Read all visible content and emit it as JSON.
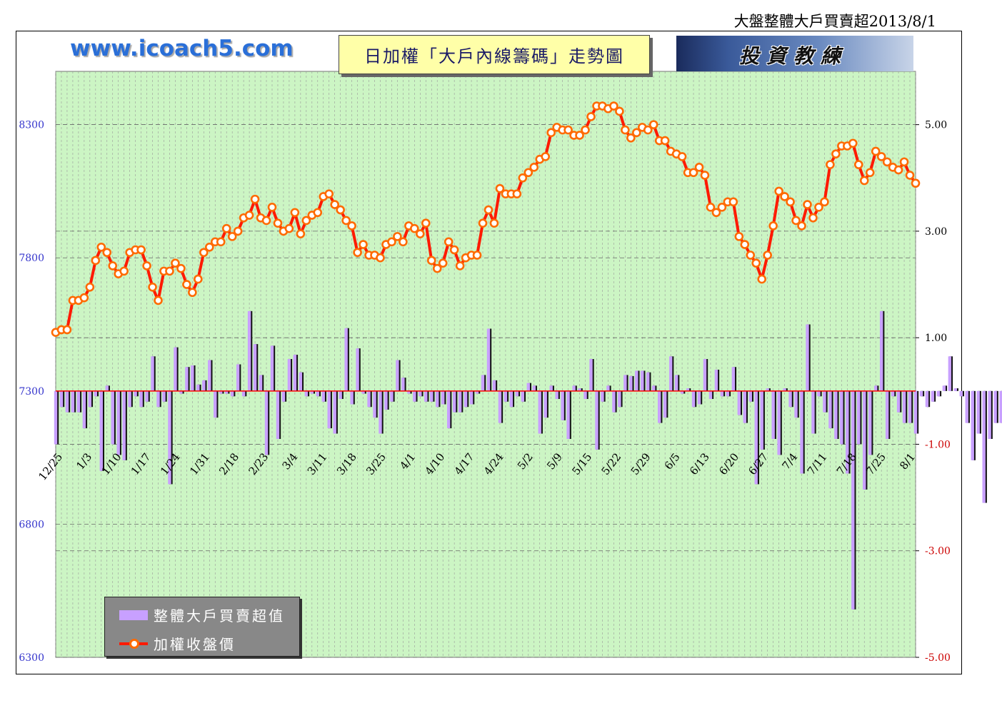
{
  "top_title": "大盤整體大戶買賣超2013/8/1",
  "site_label": "www.icoach5.com",
  "headline": "日加權「大戶內線籌碼」走勢圖",
  "logo_text": "投資教練",
  "colors": {
    "plot_bg": "#ccf5c4",
    "line": "#ff1a00",
    "marker_edge": "#ff6a00",
    "bar": "#c8a0ff",
    "left_axis_text": "#3333cc",
    "right_axis_text": "#cc0000",
    "zero_line": "#ff0000"
  },
  "legend": {
    "bar_label": "整體大戶買賣超值",
    "line_label": "加權收盤價"
  },
  "chart_data": {
    "type": "bar",
    "left_axis": {
      "ticks": [
        "8300",
        "7800",
        "7300",
        "6800",
        "6300"
      ],
      "range": [
        6300,
        8500
      ],
      "series": "加權收盤價"
    },
    "right_axis": {
      "ticks": [
        "5.00",
        "3.00",
        "1.00",
        "-1.00",
        "-3.00",
        "-5.00"
      ],
      "range": [
        -5,
        6
      ]
    },
    "x_tick_labels": [
      "12/25",
      "1/3",
      "1/10",
      "1/17",
      "1/24",
      "1/31",
      "2/18",
      "2/23",
      "3/4",
      "3/11",
      "3/18",
      "3/25",
      "4/1",
      "4/10",
      "4/17",
      "4/24",
      "5/2",
      "5/9",
      "5/15",
      "5/22",
      "5/29",
      "6/5",
      "6/13",
      "6/20",
      "6/27",
      "7/4",
      "7/11",
      "7/18",
      "7/25",
      "8/1"
    ],
    "grid": true,
    "series": [
      {
        "name": "加權收盤價",
        "type": "line",
        "values": [
          7520,
          7530,
          7530,
          7640,
          7640,
          7650,
          7690,
          7790,
          7840,
          7820,
          7770,
          7740,
          7750,
          7820,
          7830,
          7830,
          7770,
          7690,
          7640,
          7750,
          7750,
          7780,
          7760,
          7700,
          7670,
          7720,
          7820,
          7840,
          7860,
          7860,
          7910,
          7880,
          7900,
          7950,
          7960,
          8020,
          7950,
          7940,
          7990,
          7930,
          7900,
          7910,
          7970,
          7890,
          7940,
          7960,
          7970,
          8030,
          8040,
          8000,
          7980,
          7940,
          7920,
          7820,
          7850,
          7810,
          7810,
          7800,
          7850,
          7860,
          7880,
          7860,
          7920,
          7910,
          7890,
          7930,
          7790,
          7760,
          7780,
          7860,
          7830,
          7770,
          7800,
          7810,
          7810,
          7930,
          7980,
          7930,
          8060,
          8040,
          8040,
          8040,
          8100,
          8120,
          8140,
          8170,
          8180,
          8270,
          8290,
          8280,
          8280,
          8260,
          8260,
          8280,
          8330,
          8370,
          8370,
          8360,
          8370,
          8350,
          8280,
          8250,
          8270,
          8290,
          8280,
          8300,
          8240,
          8240,
          8200,
          8190,
          8180,
          8120,
          8120,
          8140,
          8110,
          7990,
          7970,
          7990,
          8010,
          8010,
          7880,
          7850,
          7810,
          7780,
          7720,
          7810,
          7920,
          8050,
          8030,
          8010,
          7940,
          7920,
          8000,
          7950,
          7990,
          8010,
          8150,
          8190,
          8220,
          8220,
          8230,
          8150,
          8090,
          8120,
          8200,
          8180,
          8160,
          8140,
          8130,
          8160,
          8110,
          8080
        ]
      },
      {
        "name": "整體大戶買賣超值",
        "type": "bar",
        "values": [
          -1.0,
          -0.3,
          -0.4,
          -0.4,
          -0.4,
          -0.7,
          -0.3,
          -0.1,
          -1.5,
          0.1,
          -1.0,
          -1.2,
          -1.3,
          -0.3,
          -0.1,
          -0.3,
          -0.2,
          0.65,
          -0.3,
          -0.2,
          -1.75,
          0.82,
          -0.05,
          0.45,
          0.48,
          0.12,
          0.2,
          0.58,
          -0.5,
          -0.05,
          -0.05,
          -0.1,
          0.5,
          -0.1,
          1.5,
          0.88,
          0.3,
          -1.2,
          0.85,
          -0.9,
          -0.2,
          0.6,
          0.68,
          0.35,
          -0.1,
          -0.05,
          -0.1,
          -0.2,
          -0.7,
          -0.8,
          -0.15,
          1.18,
          -0.25,
          0.8,
          -0.05,
          -0.3,
          -0.5,
          -0.8,
          -0.35,
          -0.2,
          0.58,
          0.25,
          -0.05,
          -0.2,
          -0.1,
          -0.2,
          -0.2,
          -0.3,
          -0.25,
          -0.7,
          -0.4,
          -0.4,
          -0.3,
          -0.25,
          -0.05,
          0.3,
          1.17,
          0.2,
          -0.6,
          -0.2,
          -0.3,
          -0.1,
          -0.2,
          0.15,
          0.1,
          -0.8,
          -0.5,
          0.1,
          -0.15,
          -0.55,
          -0.9,
          0.1,
          0.05,
          -0.15,
          0.6,
          -1.1,
          -0.2,
          0.1,
          -0.4,
          -0.3,
          0.3,
          0.28,
          0.38,
          0.38,
          0.35,
          0.1,
          -0.6,
          -0.5,
          0.65,
          0.3,
          -0.05,
          0.05,
          -0.3,
          -0.25,
          0.6,
          -0.15,
          0.4,
          -0.1,
          -0.1,
          0.45,
          -0.45,
          -0.6,
          -0.2,
          -1.75,
          -1.1,
          0.05,
          -0.9,
          -1.2,
          0.05,
          -0.3,
          -0.5,
          -1.55,
          1.25,
          -0.8,
          -0.1,
          -0.4,
          -0.7,
          -0.9,
          -1.0,
          -1.55,
          -4.1,
          -1.0,
          -1.85,
          -1.2,
          0.1,
          1.5,
          -0.9,
          -0.1,
          -0.4,
          -0.6,
          -0.6,
          -0.8,
          -0.1,
          -0.3,
          -0.2,
          -0.1,
          0.1,
          0.65,
          0.05,
          -0.1,
          -0.6,
          -1.3,
          -0.8,
          -2.1,
          -0.9,
          -0.6,
          -0.6,
          -1.1,
          -0.7,
          -0.5,
          -0.3,
          -0.4,
          -1.0,
          -0.4,
          -0.8
        ]
      }
    ]
  }
}
